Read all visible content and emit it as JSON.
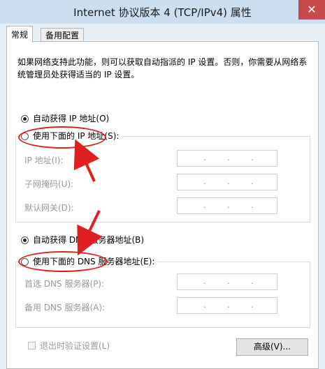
{
  "window": {
    "title": "Internet 协议版本 4 (TCP/IPv4) 属性",
    "close_glyph": "✕"
  },
  "tabs": [
    {
      "label": "常规",
      "active": true
    },
    {
      "label": "备用配置",
      "active": false
    }
  ],
  "description": "如果网络支持此功能，则可以获取自动指派的 IP 设置。否则，你需要从网络系统管理员处获得适当的 IP 设置。",
  "ip_section": {
    "auto_label": "自动获得 IP 地址(O)",
    "auto_checked": true,
    "manual_label": "使用下面的 IP 地址(S):",
    "manual_checked": false,
    "fields": [
      {
        "label": "IP 地址(I):"
      },
      {
        "label": "子网掩码(U):"
      },
      {
        "label": "默认网关(D):"
      }
    ]
  },
  "dns_section": {
    "auto_label": "自动获得 DNS 服务器地址(B)",
    "auto_checked": true,
    "manual_label": "使用下面的 DNS 服务器地址(E):",
    "manual_checked": false,
    "fields": [
      {
        "label": "首选 DNS 服务器(P):"
      },
      {
        "label": "备用 DNS 服务器(A):"
      }
    ]
  },
  "ip_dot": ".",
  "validate_label": "退出时验证设置(L)",
  "validate_checked": false,
  "advanced_label": "高级(V)...",
  "annotation_color": "#e02020"
}
